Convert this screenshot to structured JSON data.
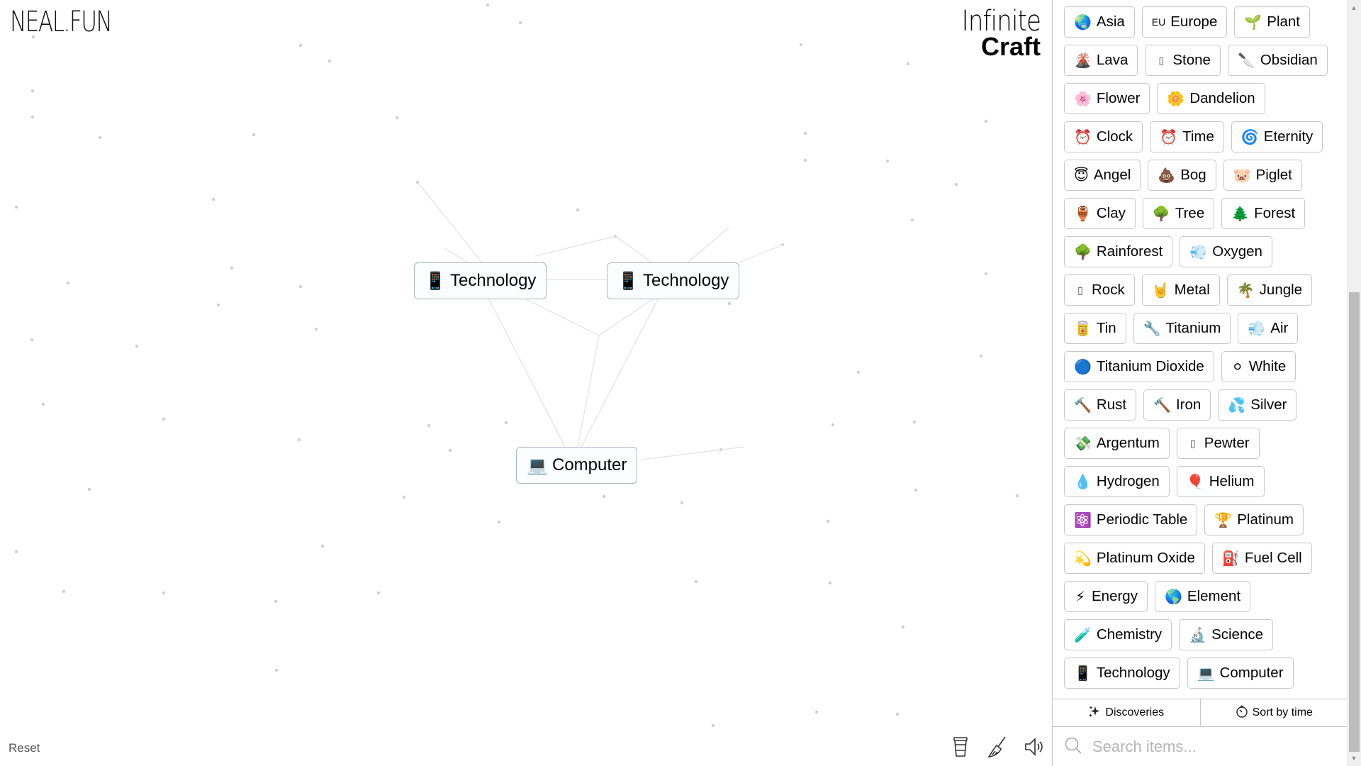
{
  "header": {
    "logo": "NEAL.FUN",
    "title_line1": "Infinite",
    "title_line2": "Craft"
  },
  "canvas": {
    "nodes": [
      {
        "emoji": "📱",
        "icon": "mobile-phone-icon",
        "label": "Technology"
      },
      {
        "emoji": "📱",
        "icon": "mobile-phone-icon",
        "label": "Technology"
      },
      {
        "emoji": "💻",
        "icon": "laptop-icon",
        "label": "Computer"
      }
    ],
    "reset_label": "Reset",
    "tools": [
      {
        "name": "coffee-cup-icon",
        "label": "Donate"
      },
      {
        "name": "broom-icon",
        "label": "Clear"
      },
      {
        "name": "speaker-icon",
        "label": "Sound"
      }
    ]
  },
  "sidebar": {
    "items": [
      {
        "emoji": "",
        "icon": "hidden-icon",
        "label": ""
      },
      {
        "emoji": "",
        "icon": "hidden-icon",
        "label": ""
      },
      {
        "emoji": "🌏",
        "icon": "globe-asia-icon",
        "label": "Asia"
      },
      {
        "emoji": "EU",
        "icon": "eu-flag-icon",
        "label": "Europe"
      },
      {
        "emoji": "🌱",
        "icon": "seedling-icon",
        "label": "Plant"
      },
      {
        "emoji": "🌋",
        "icon": "volcano-icon",
        "label": "Lava"
      },
      {
        "emoji": "▯",
        "icon": "missing-glyph-icon",
        "label": "Stone"
      },
      {
        "emoji": "🔪",
        "icon": "knife-icon",
        "label": "Obsidian"
      },
      {
        "emoji": "🌸",
        "icon": "cherry-blossom-icon",
        "label": "Flower"
      },
      {
        "emoji": "🌼",
        "icon": "blossom-icon",
        "label": "Dandelion"
      },
      {
        "emoji": "⏰",
        "icon": "alarm-clock-icon",
        "label": "Clock"
      },
      {
        "emoji": "⏰",
        "icon": "alarm-clock-icon",
        "label": "Time"
      },
      {
        "emoji": "🌀",
        "icon": "cyclone-icon",
        "label": "Eternity"
      },
      {
        "emoji": "😇",
        "icon": "angel-icon",
        "label": "Angel"
      },
      {
        "emoji": "💩",
        "icon": "poop-icon",
        "label": "Bog"
      },
      {
        "emoji": "🐷",
        "icon": "pig-face-icon",
        "label": "Piglet"
      },
      {
        "emoji": "🏺",
        "icon": "amphora-icon",
        "label": "Clay"
      },
      {
        "emoji": "🌳",
        "icon": "tree-icon",
        "label": "Tree"
      },
      {
        "emoji": "🌲",
        "icon": "evergreen-tree-icon",
        "label": "Forest"
      },
      {
        "emoji": "🌳",
        "icon": "tree-icon",
        "label": "Rainforest"
      },
      {
        "emoji": "💨",
        "icon": "wind-icon",
        "label": "Oxygen"
      },
      {
        "emoji": "▯",
        "icon": "missing-glyph-icon",
        "label": "Rock"
      },
      {
        "emoji": "🤘",
        "icon": "rock-hand-icon",
        "label": "Metal"
      },
      {
        "emoji": "🌴",
        "icon": "palm-tree-icon",
        "label": "Jungle"
      },
      {
        "emoji": "🥫",
        "icon": "tin-can-icon",
        "label": "Tin"
      },
      {
        "emoji": "🔧",
        "icon": "wrench-icon",
        "label": "Titanium"
      },
      {
        "emoji": "💨",
        "icon": "wind-icon",
        "label": "Air"
      },
      {
        "emoji": "🔵",
        "icon": "blue-circle-icon",
        "label": "Titanium Dioxide"
      },
      {
        "emoji": "⚪",
        "icon": "white-circle-icon",
        "label": "White"
      },
      {
        "emoji": "🔨",
        "icon": "hammer-icon",
        "label": "Rust"
      },
      {
        "emoji": "🔨",
        "icon": "hammer-icon",
        "label": "Iron"
      },
      {
        "emoji": "💦",
        "icon": "droplets-icon",
        "label": "Silver"
      },
      {
        "emoji": "💸",
        "icon": "money-wings-icon",
        "label": "Argentum"
      },
      {
        "emoji": "▯",
        "icon": "missing-glyph-icon",
        "label": "Pewter"
      },
      {
        "emoji": "💧",
        "icon": "droplet-icon",
        "label": "Hydrogen"
      },
      {
        "emoji": "🎈",
        "icon": "balloon-icon",
        "label": "Helium"
      },
      {
        "emoji": "⚛️",
        "icon": "atom-icon",
        "label": "Periodic Table"
      },
      {
        "emoji": "🏆",
        "icon": "trophy-icon",
        "label": "Platinum"
      },
      {
        "emoji": "💫",
        "icon": "dizzy-ring-icon",
        "label": "Platinum Oxide"
      },
      {
        "emoji": "⛽",
        "icon": "fuel-pump-icon",
        "label": "Fuel Cell"
      },
      {
        "emoji": "⚡",
        "icon": "lightning-icon",
        "label": "Energy"
      },
      {
        "emoji": "🌎",
        "icon": "globe-americas-icon",
        "label": "Element"
      },
      {
        "emoji": "🧪",
        "icon": "test-tube-icon",
        "label": "Chemistry"
      },
      {
        "emoji": "🔬",
        "icon": "microscope-icon",
        "label": "Science"
      },
      {
        "emoji": "📱",
        "icon": "mobile-phone-icon",
        "label": "Technology"
      },
      {
        "emoji": "💻",
        "icon": "laptop-icon",
        "label": "Computer"
      }
    ],
    "discoveries_label": "Discoveries",
    "sort_label": "Sort by time",
    "search_placeholder": "Search items...",
    "search_value": ""
  }
}
